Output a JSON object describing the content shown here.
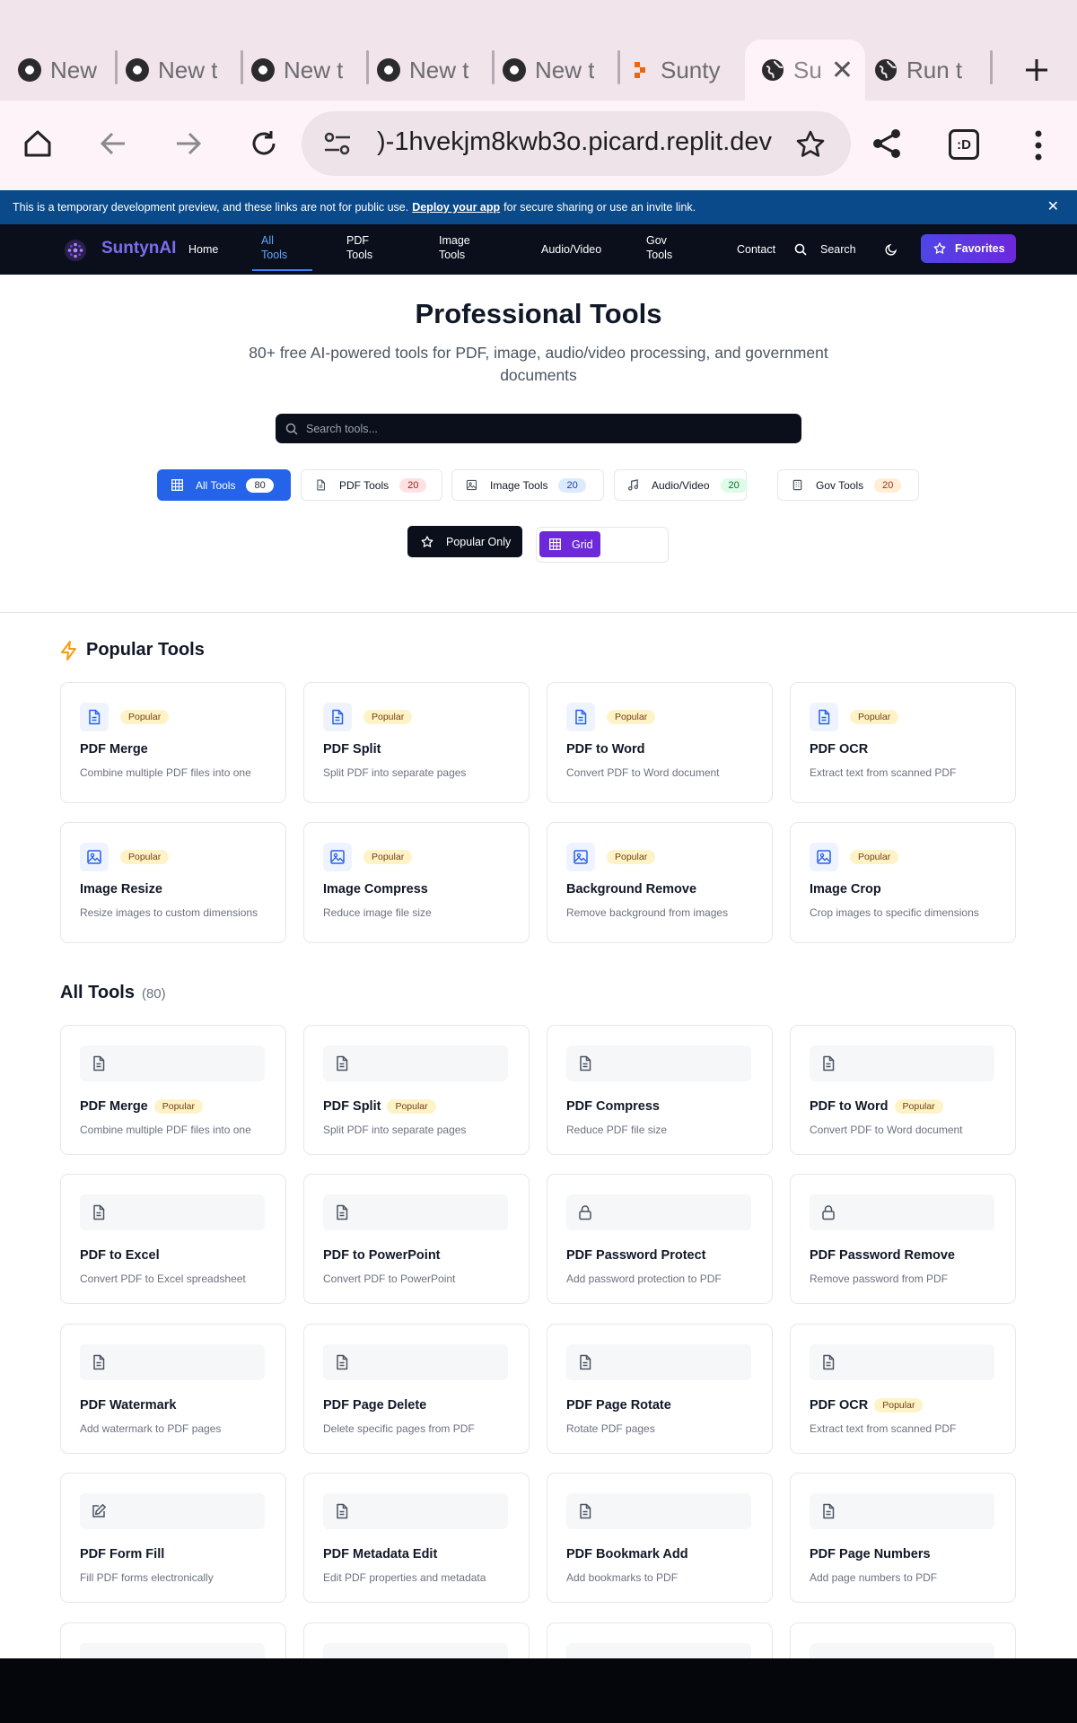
{
  "browser": {
    "tabs": [
      {
        "title": "New t",
        "icon": "chrome"
      },
      {
        "title": "New t",
        "icon": "chrome"
      },
      {
        "title": "New t",
        "icon": "chrome"
      },
      {
        "title": "New t",
        "icon": "chrome"
      },
      {
        "title": "New t",
        "icon": "chrome"
      },
      {
        "title": "Sunty",
        "icon": "replit"
      },
      {
        "title": "Su",
        "icon": "globe",
        "active": true
      },
      {
        "title": "Run t",
        "icon": "globe"
      }
    ],
    "url": ")-1hvekjm8kwb3o.picard.replit.dev",
    "extension_label": ":D"
  },
  "banner": {
    "text_before": "This is a temporary development preview, and these links are not for public use.",
    "link": "Deploy your app",
    "text_after": "for secure sharing or use an invite link."
  },
  "nav": {
    "brand": "SuntynAI",
    "home": "Home",
    "all_tools": [
      "All",
      "Tools"
    ],
    "pdf_tools": [
      "PDF",
      "Tools"
    ],
    "image_tools": [
      "Image",
      "Tools"
    ],
    "audio_video": "Audio/Video",
    "gov_tools": [
      "Gov",
      "Tools"
    ],
    "contact": "Contact",
    "search": "Search",
    "favorites": "Favorites"
  },
  "hero": {
    "title": "Professional Tools",
    "subtitle": "80+ free AI-powered tools for PDF, image, audio/video processing, and government documents",
    "search_placeholder": "Search tools..."
  },
  "filters": [
    {
      "label": "All Tools",
      "count": "80",
      "active": true
    },
    {
      "label": "PDF Tools",
      "count": "20"
    },
    {
      "label": "Image Tools",
      "count": "20"
    },
    {
      "label": "Audio/Video",
      "count": "20"
    },
    {
      "label": "Gov Tools",
      "count": "20"
    }
  ],
  "view": {
    "popular_only": "Popular Only",
    "grid": "Grid"
  },
  "popular_section": {
    "title": "Popular Tools",
    "badge": "Popular",
    "items": [
      {
        "name": "PDF Merge",
        "desc": "Combine multiple PDF files into one",
        "icon": "document"
      },
      {
        "name": "PDF Split",
        "desc": "Split PDF into separate pages",
        "icon": "document"
      },
      {
        "name": "PDF to Word",
        "desc": "Convert PDF to Word document",
        "icon": "document"
      },
      {
        "name": "PDF OCR",
        "desc": "Extract text from scanned PDF",
        "icon": "document"
      },
      {
        "name": "Image Resize",
        "desc": "Resize images to custom dimensions",
        "icon": "image"
      },
      {
        "name": "Image Compress",
        "desc": "Reduce image file size",
        "icon": "image"
      },
      {
        "name": "Background Remove",
        "desc": "Remove background from images",
        "icon": "image"
      },
      {
        "name": "Image Crop",
        "desc": "Crop images to specific dimensions",
        "icon": "image"
      }
    ]
  },
  "all_section": {
    "title": "All Tools",
    "count": "(80)",
    "badge": "Popular",
    "items": [
      {
        "name": "PDF Merge",
        "desc": "Combine multiple PDF files into one",
        "icon": "document",
        "popular": true
      },
      {
        "name": "PDF Split",
        "desc": "Split PDF into separate pages",
        "icon": "document",
        "popular": true
      },
      {
        "name": "PDF Compress",
        "desc": "Reduce PDF file size",
        "icon": "document"
      },
      {
        "name": "PDF to Word",
        "desc": "Convert PDF to Word document",
        "icon": "document",
        "popular": true
      },
      {
        "name": "PDF to Excel",
        "desc": "Convert PDF to Excel spreadsheet",
        "icon": "document"
      },
      {
        "name": "PDF to PowerPoint",
        "desc": "Convert PDF to PowerPoint",
        "icon": "document"
      },
      {
        "name": "PDF Password Protect",
        "desc": "Add password protection to PDF",
        "icon": "lock"
      },
      {
        "name": "PDF Password Remove",
        "desc": "Remove password from PDF",
        "icon": "lock"
      },
      {
        "name": "PDF Watermark",
        "desc": "Add watermark to PDF pages",
        "icon": "document"
      },
      {
        "name": "PDF Page Delete",
        "desc": "Delete specific pages from PDF",
        "icon": "document"
      },
      {
        "name": "PDF Page Rotate",
        "desc": "Rotate PDF pages",
        "icon": "document"
      },
      {
        "name": "PDF OCR",
        "desc": "Extract text from scanned PDF",
        "icon": "document",
        "popular": true
      },
      {
        "name": "PDF Form Fill",
        "desc": "Fill PDF forms electronically",
        "icon": "edit"
      },
      {
        "name": "PDF Metadata Edit",
        "desc": "Edit PDF properties and metadata",
        "icon": "document"
      },
      {
        "name": "PDF Bookmark Add",
        "desc": "Add bookmarks to PDF",
        "icon": "document"
      },
      {
        "name": "PDF Page Numbers",
        "desc": "Add page numbers to PDF",
        "icon": "document"
      }
    ]
  },
  "colors": {
    "accent_blue": "#2563eb",
    "brand_purple": "#7c3aed",
    "nav_bg": "#0b0f1c",
    "banner_bg": "#0b4a8a"
  }
}
